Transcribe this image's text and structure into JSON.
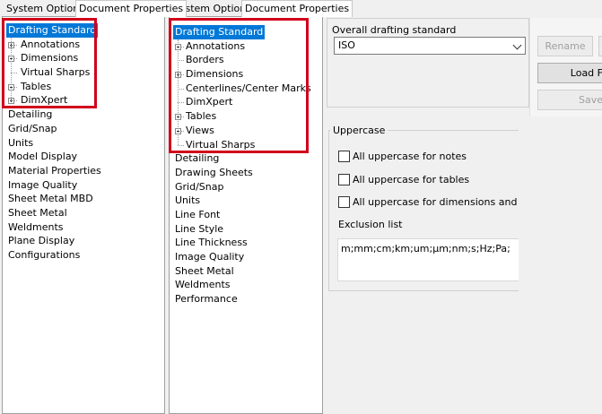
{
  "left": {
    "tabs": [
      "System Options",
      "Document Properties"
    ],
    "tree": [
      {
        "label": "Drafting Standard",
        "selected": true
      },
      {
        "label": "Annotations",
        "expandable": true
      },
      {
        "label": "Dimensions",
        "expandable": true
      },
      {
        "label": "Virtual Sharps"
      },
      {
        "label": "Tables",
        "expandable": true
      },
      {
        "label": "DimXpert",
        "expandable": true
      },
      {
        "label": "Detailing"
      },
      {
        "label": "Grid/Snap"
      },
      {
        "label": "Units"
      },
      {
        "label": "Model Display"
      },
      {
        "label": "Material Properties"
      },
      {
        "label": "Image Quality"
      },
      {
        "label": "Sheet Metal MBD"
      },
      {
        "label": "Sheet Metal"
      },
      {
        "label": "Weldments"
      },
      {
        "label": "Plane Display"
      },
      {
        "label": "Configurations"
      }
    ]
  },
  "middle": {
    "tabs": [
      "System Options",
      "Document Properties"
    ],
    "tree": [
      {
        "label": "Drafting Standard",
        "selected": true
      },
      {
        "label": "Annotations",
        "expandable": true
      },
      {
        "label": "Borders"
      },
      {
        "label": "Dimensions",
        "expandable": true
      },
      {
        "label": "Centerlines/Center Marks"
      },
      {
        "label": "DimXpert"
      },
      {
        "label": "Tables",
        "expandable": true
      },
      {
        "label": "Views",
        "expandable": true
      },
      {
        "label": "Virtual Sharps"
      },
      {
        "label": "Detailing"
      },
      {
        "label": "Drawing Sheets"
      },
      {
        "label": "Grid/Snap"
      },
      {
        "label": "Units"
      },
      {
        "label": "Line Font"
      },
      {
        "label": "Line Style"
      },
      {
        "label": "Line Thickness"
      },
      {
        "label": "Image Quality"
      },
      {
        "label": "Sheet Metal"
      },
      {
        "label": "Weldments"
      },
      {
        "label": "Performance"
      }
    ]
  },
  "right": {
    "standard_title": "Overall drafting standard",
    "standard_value": "ISO",
    "buttons": {
      "rename": "Rename",
      "load": "Load F",
      "save": "Save"
    },
    "uppercase_title": "Uppercase",
    "checkbox_notes": "All uppercase for notes",
    "checkbox_tables": "All uppercase for tables",
    "checkbox_dims": "All uppercase for dimensions and hole ca",
    "exclusion_label": "Exclusion list",
    "exclusion_value": "m;mm;cm;km;um;µm;nm;s;Hz;Pa;"
  }
}
